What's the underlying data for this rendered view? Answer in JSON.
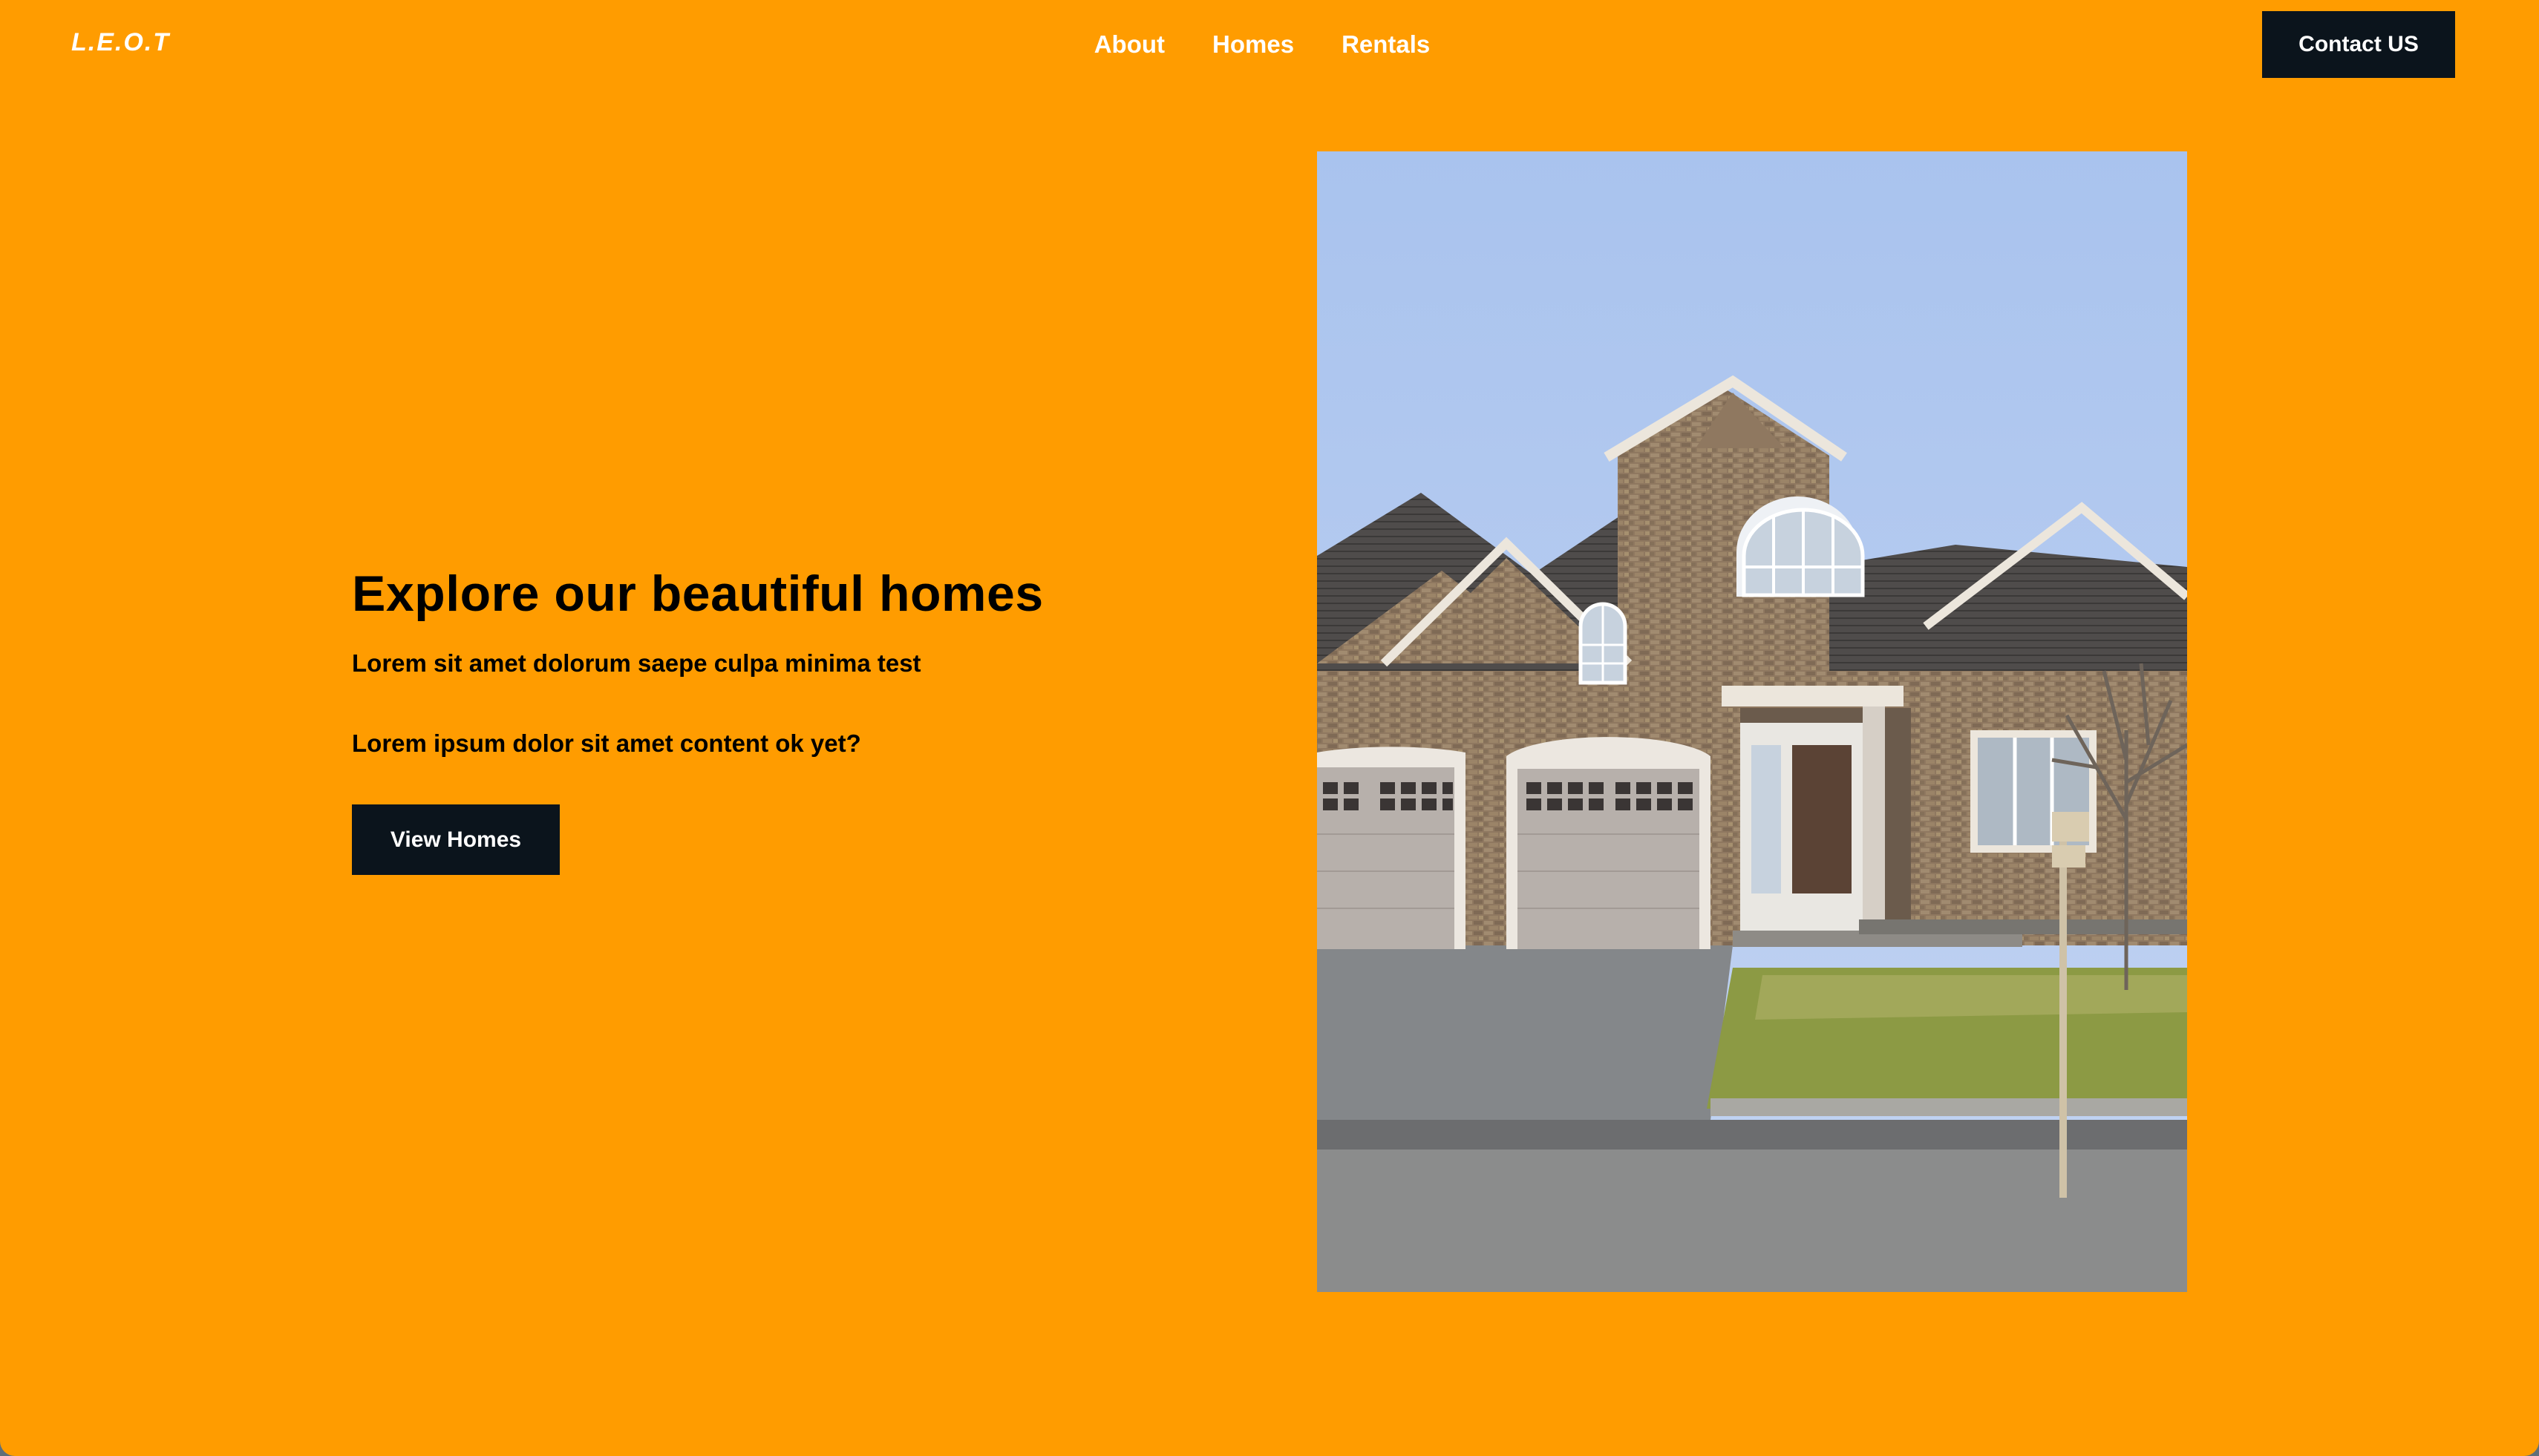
{
  "header": {
    "logo": "L.E.O.T",
    "nav": [
      {
        "label": "About"
      },
      {
        "label": "Homes"
      },
      {
        "label": "Rentals"
      }
    ],
    "contact_label": "Contact US"
  },
  "hero": {
    "title": "Explore our beautiful homes",
    "line1": "Lorem sit amet dolorum saepe culpa minima test",
    "line2": "Lorem ipsum dolor sit amet content ok yet?",
    "button_label": "View Homes"
  },
  "colors": {
    "background": "#ff9c00",
    "button": "#0b141c",
    "nav_text": "#ffffff"
  }
}
